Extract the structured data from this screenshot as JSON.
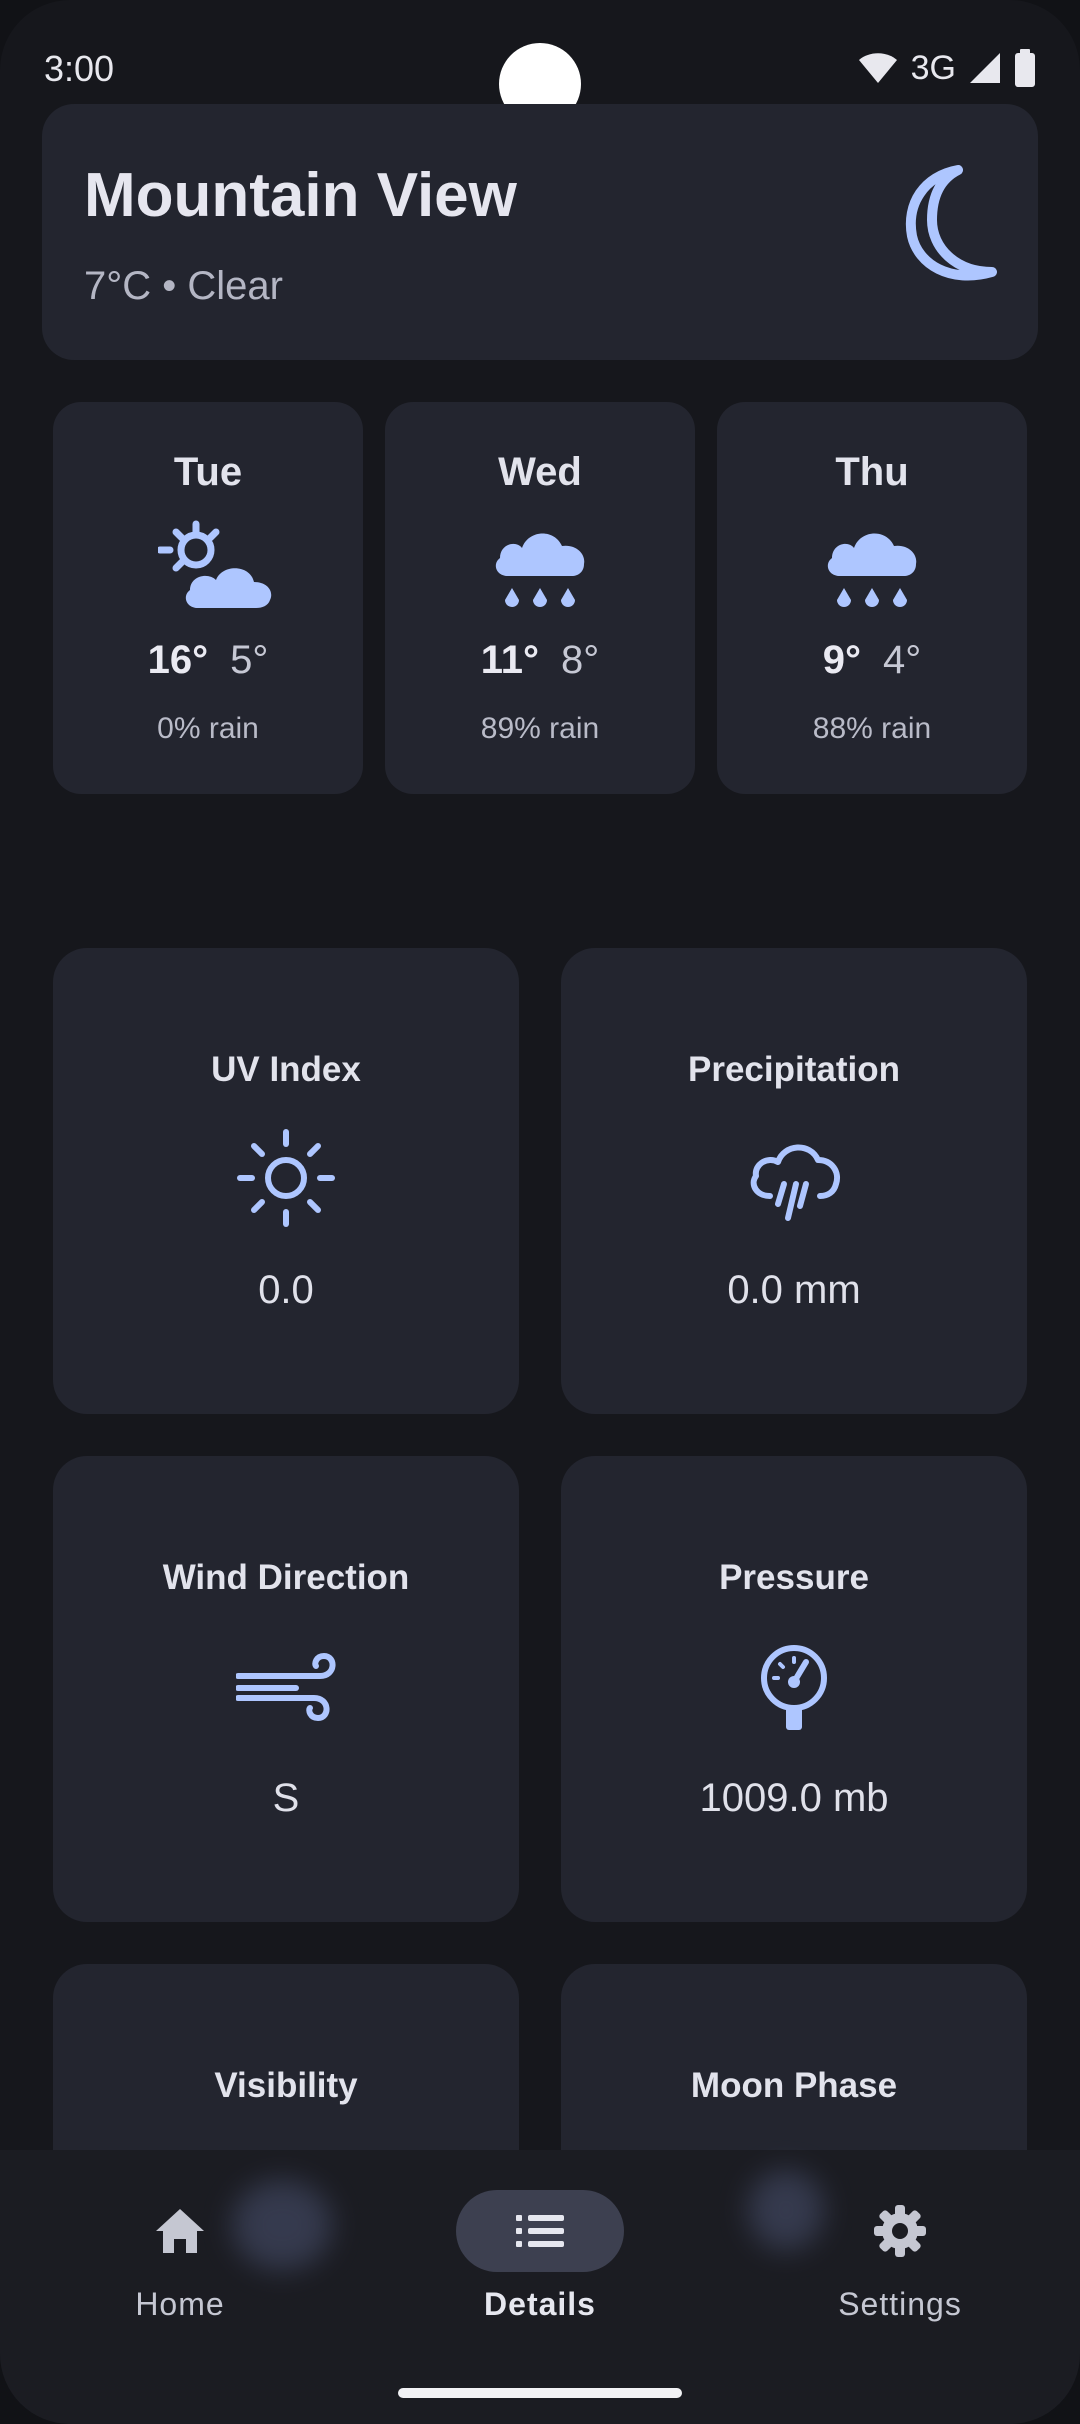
{
  "status": {
    "time": "3:00",
    "network": "3G"
  },
  "header": {
    "city": "Mountain View",
    "summary": "7°C • Clear",
    "icon": "moon-icon"
  },
  "forecast": [
    {
      "day": "Tue",
      "high": "16°",
      "low": "5°",
      "rain": "0% rain",
      "icon": "sun-cloud-icon"
    },
    {
      "day": "Wed",
      "high": "11°",
      "low": "8°",
      "rain": "89% rain",
      "icon": "rain-cloud-icon"
    },
    {
      "day": "Thu",
      "high": "9°",
      "low": "4°",
      "rain": "88% rain",
      "icon": "rain-cloud-icon"
    }
  ],
  "details": [
    {
      "title": "UV Index",
      "value": "0.0",
      "icon": "sun-icon"
    },
    {
      "title": "Precipitation",
      "value": "0.0 mm",
      "icon": "rain-shower-icon"
    },
    {
      "title": "Wind Direction",
      "value": "S",
      "icon": "wind-icon"
    },
    {
      "title": "Pressure",
      "value": "1009.0 mb",
      "icon": "gauge-icon"
    },
    {
      "title": "Visibility",
      "value": "",
      "icon": ""
    },
    {
      "title": "Moon Phase",
      "value": "",
      "icon": ""
    }
  ],
  "nav": [
    {
      "label": "Home",
      "icon": "home-icon",
      "active": false
    },
    {
      "label": "Details",
      "icon": "list-icon",
      "active": true
    },
    {
      "label": "Settings",
      "icon": "gear-icon",
      "active": false
    }
  ],
  "colors": {
    "accent": "#aec6ff",
    "card": "#23252f",
    "background": "#16171c"
  }
}
